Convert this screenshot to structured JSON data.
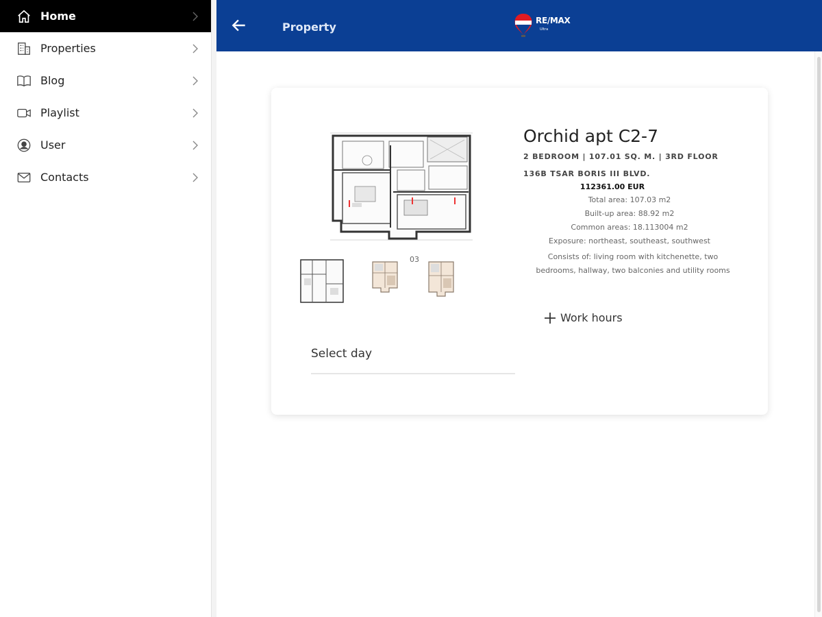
{
  "sidebar": {
    "items": [
      {
        "label": "Home",
        "icon": "home-icon",
        "active": true
      },
      {
        "label": "Properties",
        "icon": "building-icon"
      },
      {
        "label": "Blog",
        "icon": "book-icon"
      },
      {
        "label": "Playlist",
        "icon": "video-icon"
      },
      {
        "label": "User",
        "icon": "user-icon"
      },
      {
        "label": "Contacts",
        "icon": "mail-icon"
      }
    ]
  },
  "header": {
    "title": "Property",
    "logo_text": "RE/MAX",
    "logo_sub": "Ultra",
    "background": "#0b3f94"
  },
  "property": {
    "title": "Orchid apt C2-7",
    "summary": "2 BEDROOM | 107.01 SQ. M. | 3RD FLOOR",
    "address": "136B TSAR BORIS III BLVD.",
    "price": "112361.00 EUR",
    "total_area": "Total area: 107.03 m2",
    "built_up_area": "Built-up area: 88.92 m2",
    "common_areas": "Common areas: 18.113004 m2",
    "exposure": "Exposure: northeast, southeast, southwest",
    "consists_of": "Consists of: living room with kitchenette, two bedrooms, hallway, two balconies and utility rooms",
    "work_hours": "Work hours",
    "gallery_counter": "03"
  },
  "select_day": {
    "label": "Select day"
  }
}
